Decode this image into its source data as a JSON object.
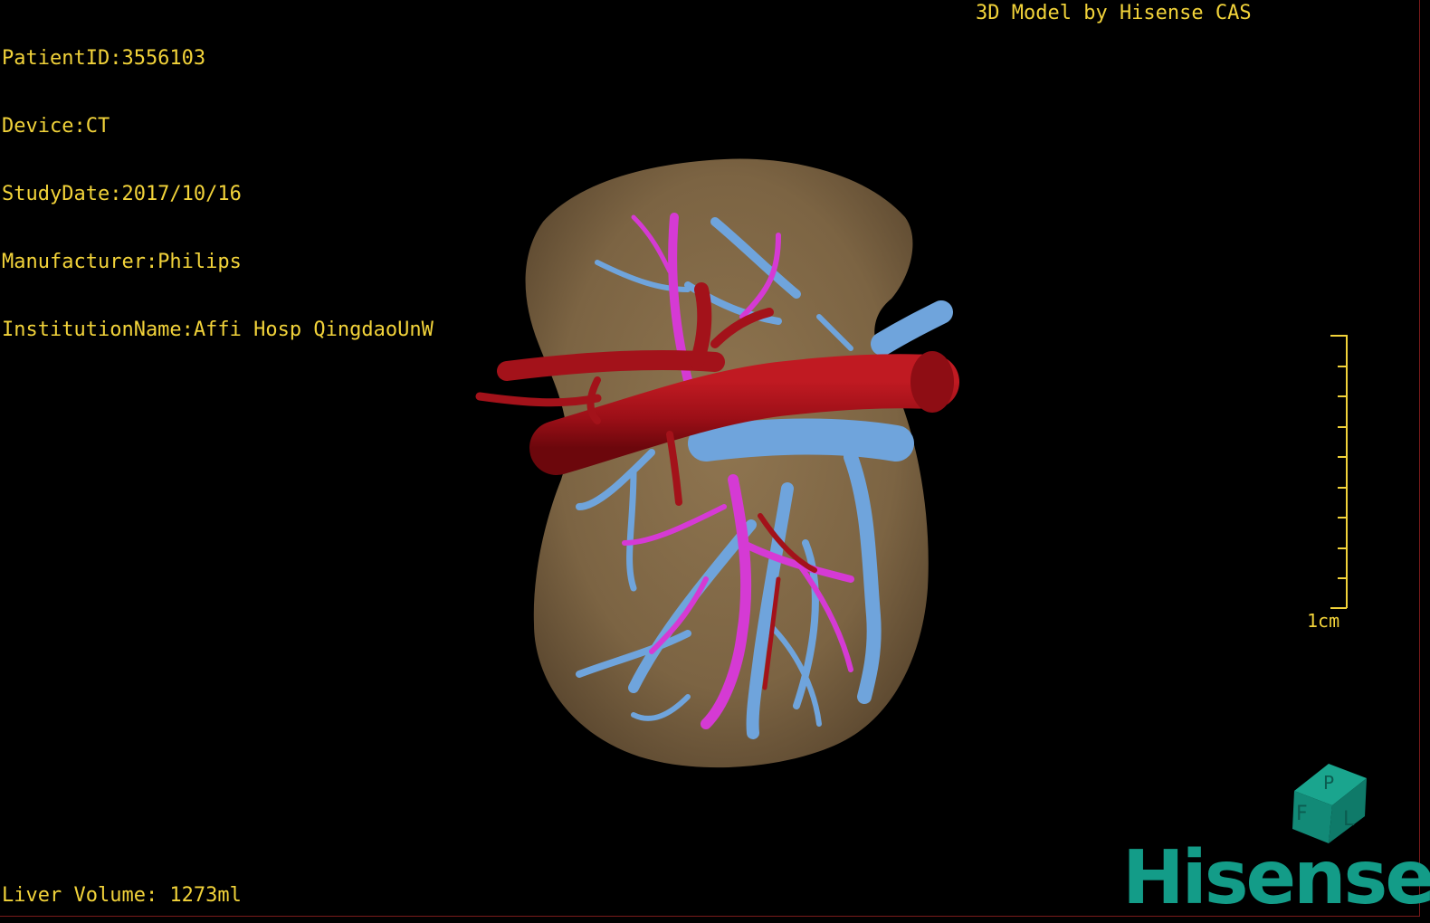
{
  "overlay": {
    "patient_id": "PatientID:3556103",
    "device": "Device:CT",
    "study_date": "StudyDate:2017/10/16",
    "manufacturer": "Manufacturer:Philips",
    "institution": "InstitutionName:Affi Hosp QingdaoUnW",
    "credit": "3D Model by Hisense CAS",
    "liver_volume": "Liver Volume: 1273ml"
  },
  "scale_bar": {
    "label": "1cm"
  },
  "orientation_cube": {
    "face_left": "F",
    "face_right": "L",
    "face_top": "P"
  },
  "logo": {
    "text": "Hisense"
  },
  "colors": {
    "overlay_text": "#f2d33a",
    "liver": "#8a6f4a",
    "hepatic_artery": "#a3121a",
    "portal_vein": "#6fa4dc",
    "hepatic_vein": "#d53ad4",
    "brand": "#139c88"
  }
}
